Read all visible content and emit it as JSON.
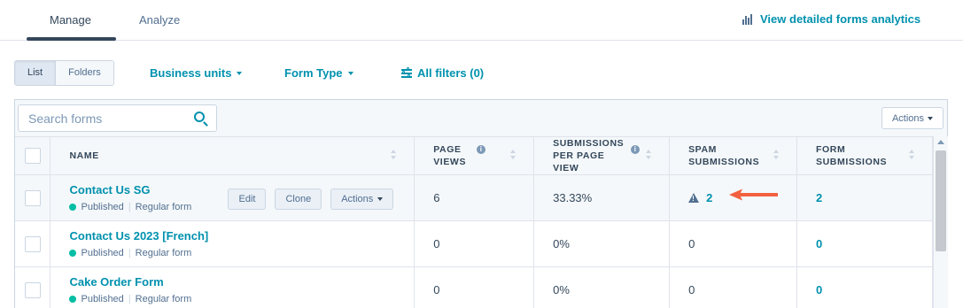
{
  "tabs": {
    "manage": "Manage",
    "analyze": "Analyze",
    "analytics_link": "View detailed forms analytics"
  },
  "toolbar": {
    "list": "List",
    "folders": "Folders",
    "business_units": "Business units",
    "form_type": "Form Type",
    "all_filters": "All filters (0)"
  },
  "search": {
    "placeholder": "Search forms"
  },
  "actions_button": "Actions",
  "columns": {
    "name": "NAME",
    "page_views": "PAGE\nVIEWS",
    "submissions_per_view": "SUBMISSIONS\nPER PAGE\nVIEW",
    "spam": "SPAM\nSUBMISSIONS",
    "form_submissions": "FORM\nSUBMISSIONS"
  },
  "row_actions": {
    "edit": "Edit",
    "clone": "Clone",
    "actions": "Actions"
  },
  "rows": [
    {
      "name": "Contact Us SG",
      "status": "Published",
      "type": "Regular form",
      "page_views": "6",
      "rate": "33.33%",
      "spam": "2",
      "submissions": "2"
    },
    {
      "name": "Contact Us 2023 [French]",
      "status": "Published",
      "type": "Regular form",
      "page_views": "0",
      "rate": "0%",
      "spam": "0",
      "submissions": "0"
    },
    {
      "name": "Cake Order Form",
      "status": "Published",
      "type": "Regular form",
      "page_views": "0",
      "rate": "0%",
      "spam": "0",
      "submissions": "0"
    }
  ],
  "colors": {
    "accent": "#0091ae",
    "published": "#00bda5",
    "arrow": "#f2613f",
    "text": "#33475b"
  }
}
